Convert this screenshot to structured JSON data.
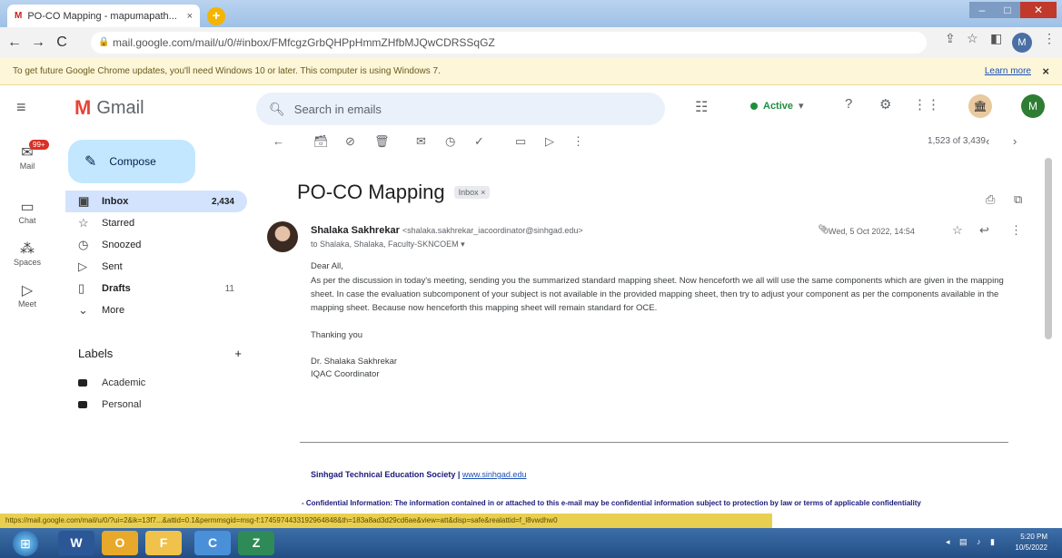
{
  "browser": {
    "tab_title": "PO-CO Mapping - mapumapath...",
    "tab_close": "×",
    "new_tab": "+",
    "address": "mail.google.com/mail/u/0/#inbox/FMfcgzGrbQHPpHmmZHfbMJQwCDRSSqGZ",
    "nav_back": "←",
    "nav_forward": "→",
    "nav_reload": "C",
    "icons": [
      "share-icon",
      "bookmark-star-icon",
      "sidebar-icon",
      "profile-avatar"
    ],
    "profile_initial": "M"
  },
  "infobar": {
    "message": "To get future Google Chrome updates, you'll need Windows 10 or later. This computer is using Windows 7.",
    "learn_more": "Learn more",
    "close": "×"
  },
  "gmail": {
    "app_name": "Gmail",
    "search_placeholder": "Search in emails",
    "status": "Active",
    "account_initial": "M",
    "rail": [
      {
        "label": "Mail",
        "badge": "99+"
      },
      {
        "label": "Chat"
      },
      {
        "label": "Spaces"
      },
      {
        "label": "Meet"
      }
    ],
    "compose": "Compose",
    "nav": [
      {
        "label": "Inbox",
        "count": "2,434"
      },
      {
        "label": "Starred",
        "count": ""
      },
      {
        "label": "Snoozed",
        "count": ""
      },
      {
        "label": "Sent",
        "count": ""
      },
      {
        "label": "Drafts",
        "count": "11"
      },
      {
        "label": "More",
        "count": ""
      }
    ],
    "labels_heading": "Labels",
    "labels_add": "+",
    "labels": [
      "Academic",
      "Personal"
    ],
    "pager": "1,523 of 3,439",
    "email": {
      "subject": "PO-CO Mapping",
      "chip": "Inbox ×",
      "sender_name": "Shalaka Sakhrekar",
      "sender_email": "<shalaka.sakhrekar_iacoordinator@sinhgad.edu>",
      "to": "to Shalaka, Shalaka, Faculty-SKNCOEM ▾",
      "date": "Wed, 5 Oct 2022, 14:54",
      "greeting": "Dear All,",
      "body": "As per the discussion in today's meeting, sending you the summarized standard mapping sheet. Now henceforth we all will use the same components which are given in the mapping sheet. In case the evaluation subcomponent of your subject is not available in the provided mapping sheet, then try to adjust your component as per the components available in the mapping sheet. Because now henceforth this mapping sheet will remain standard for OCE.",
      "thanks": "Thanking you",
      "sign_name": "Dr. Shalaka Sakhrekar",
      "sign_role": "IQAC Coordinator",
      "society_name": "Sinhgad Technical Education Society",
      "society_sep": " | ",
      "society_link": "www.sinhgad.edu",
      "confidential": "- Confidential Information: The information contained in or attached to this e-mail may be confidential information subject to protection by law or terms of applicable confidentiality"
    }
  },
  "status_url": "https://mail.google.com/mail/u/0/?ui=2&ik=13f7...&attid=0.1&permmsgid=msg-f:1745974433192964848&th=183a8ad3d29cd6ae&view=att&disp=safe&realattid=f_l8vwdhw0",
  "taskbar": {
    "apps": [
      "W",
      "O",
      "F",
      "C",
      "Z"
    ],
    "time": "5:20 PM",
    "date": "10/5/2022"
  },
  "colors": {
    "accent": "#c2e7ff",
    "inbox_active": "#d3e3fd",
    "status_green": "#1e8e3e",
    "infobar": "#fdf6d8",
    "taskbar": "#234e85"
  }
}
